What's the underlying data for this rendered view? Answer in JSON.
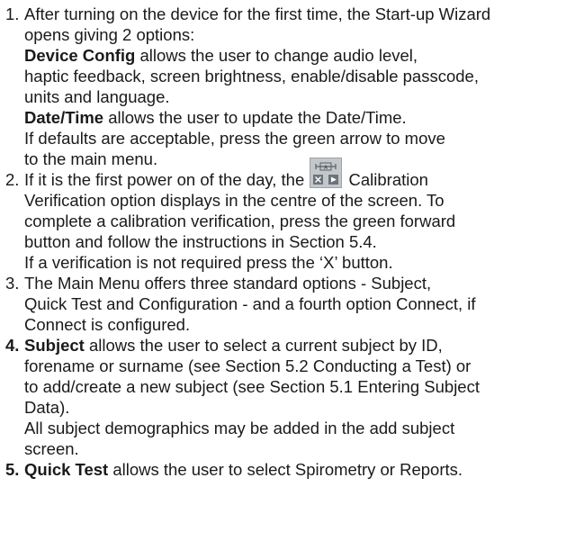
{
  "steps": [
    {
      "number": "1.",
      "lines": [
        "After turning on the device for the first time, the Start-up Wizard",
        "opens giving 2 options:"
      ],
      "device_config": {
        "term": "Device Config",
        "text1": " allows the user to change audio level,",
        "text2": "haptic feedback, screen brightness, enable/disable passcode,",
        "text3": "units and language."
      },
      "date_time": {
        "term": "Date/Time",
        "text1": " allows the user to update the Date/Time.",
        "text2": "If defaults are acceptable, press the green arrow to move",
        "text3": "to the main menu."
      }
    },
    {
      "number": "2.",
      "line1_pre": "If it is the first power on of the day, the ",
      "line1_post": " Calibration",
      "icon": "calibration-verification-icon",
      "lines": [
        "Verification option displays in the centre of the screen. To",
        "complete a calibration verification, press the green forward",
        "button and follow the instructions in Section 5.4.",
        "If a verification is not required press the ‘X’ button."
      ]
    },
    {
      "number": "3.",
      "lines": [
        "The Main Menu offers three standard options - Subject,",
        "Quick Test and Configuration - and a fourth option Connect, if",
        "Connect is configured."
      ]
    },
    {
      "number": "4.",
      "term": "Subject",
      "line1_post": " allows the user to select a current subject by ID,",
      "lines": [
        "forename or surname (see Section 5.2 Conducting a Test) or",
        "to add/create a new subject (see Section 5.1 Entering Subject",
        "Data).",
        "All subject demographics may be added in the add subject",
        "screen."
      ]
    },
    {
      "number": "5.",
      "term": "Quick Test",
      "line1_post": " allows the user to select Spirometry or Reports."
    }
  ]
}
